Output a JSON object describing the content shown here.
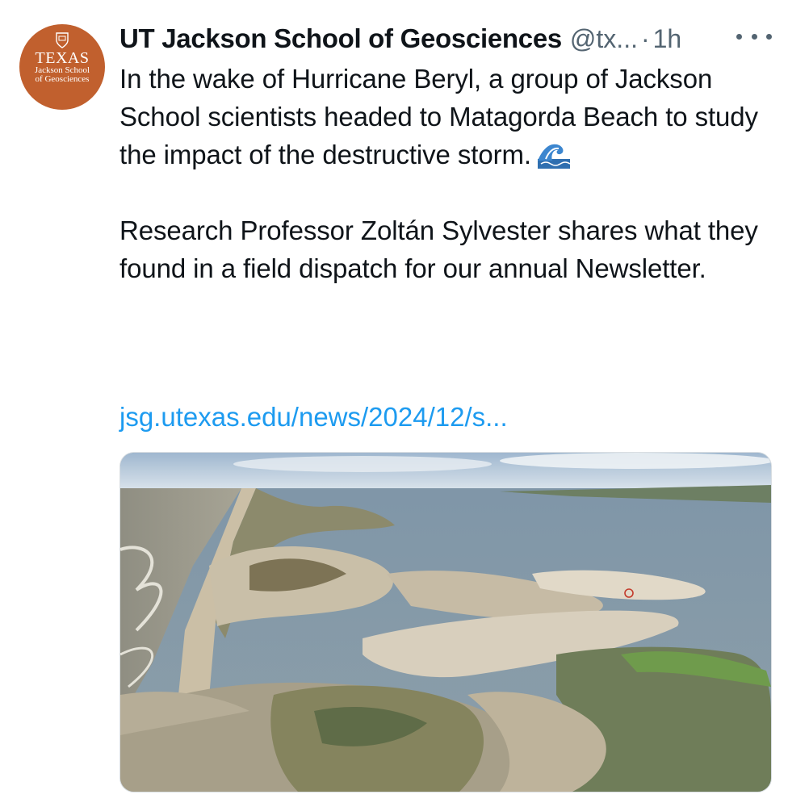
{
  "tweet": {
    "author_name": "UT Jackson School of Geosciences",
    "handle": "@tx...",
    "separator": "·",
    "time": "1h",
    "more_icon": "more-dots-icon",
    "avatar": {
      "wordmark": "TEXAS",
      "line1": "Jackson School",
      "line2": "of Geosciences",
      "color": "#c1602e"
    },
    "paragraph1": "In the wake of Hurricane Beryl, a group of Jackson School scientists headed to Matagorda Beach to study the impact of the destructive storm.",
    "emoji_icon": "water-wave-emoji",
    "paragraph2": "Research Professor Zoltán Sylvester shares what they found in a field dispatch for our annual Newsletter.",
    "link_text": "jsg.utexas.edu/news/2024/12/s...",
    "link_color": "#1d9bf0"
  },
  "media": {
    "kind": "aerial-photo",
    "subject": "barrier island coastline"
  }
}
